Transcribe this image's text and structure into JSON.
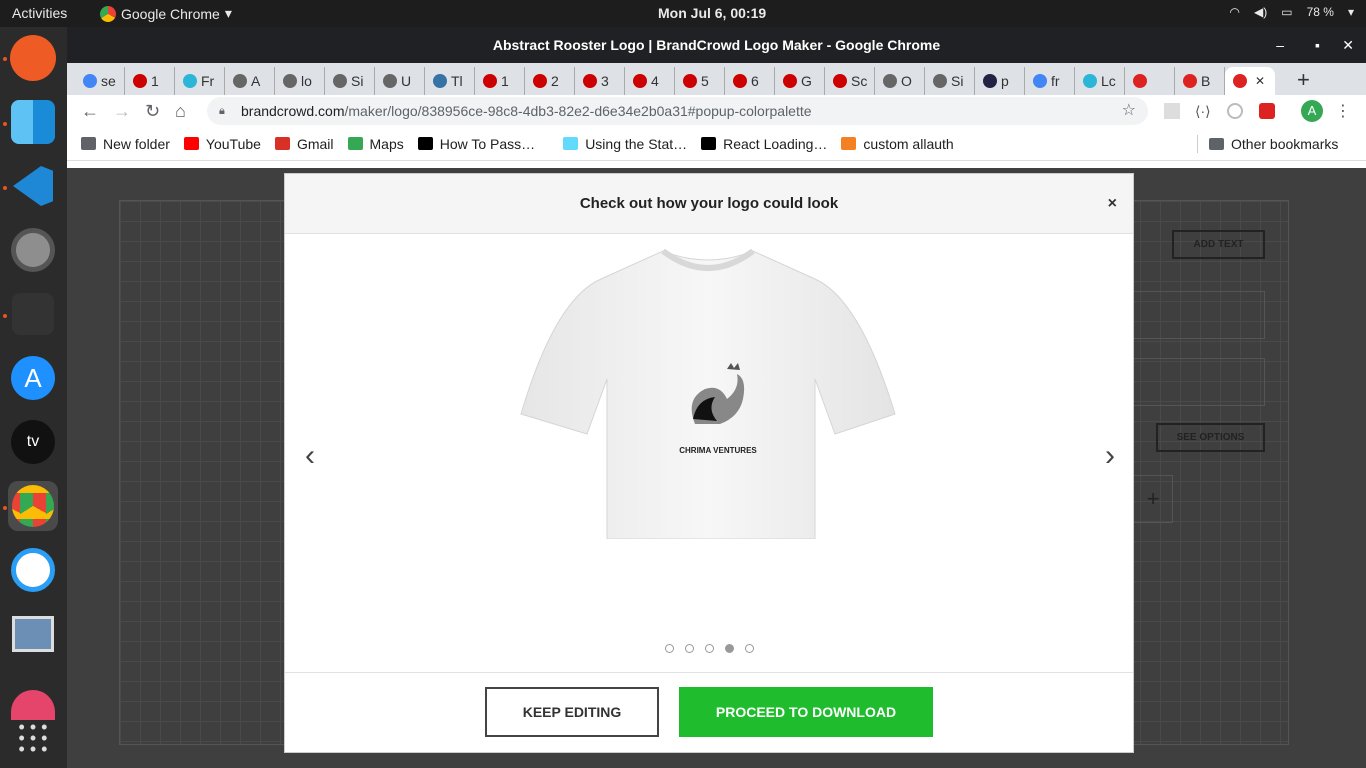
{
  "os": {
    "activities": "Activities",
    "app_name": "Google Chrome",
    "clock": "Mon Jul  6, 00:19",
    "battery": "78 %"
  },
  "window": {
    "title": "Abstract Rooster Logo | BrandCrowd Logo Maker - Google Chrome"
  },
  "tabs": [
    "se",
    "1",
    "Fr",
    "A",
    "lo",
    "Si",
    "U",
    "Tl",
    "1",
    "2",
    "3",
    "4",
    "5",
    "6",
    "G",
    "Sc",
    "O",
    "Si",
    "p",
    "fr",
    "Lc",
    "",
    "B",
    ""
  ],
  "address": {
    "domain": "brandcrowd.com",
    "path": "/maker/logo/838956ce-98c8-4db3-82e2-d6e34e2b0a31#popup-colorpalette"
  },
  "bookmarks": [
    "New folder",
    "YouTube",
    "Gmail",
    "Maps",
    "How To Pass…",
    "Using the Stat…",
    "React Loading…",
    "custom allauth"
  ],
  "other_bookmarks": "Other bookmarks",
  "profile_initial": "A",
  "modal": {
    "title": "Check out how your logo could look",
    "close": "×",
    "logo_text": "CHRIMA VENTURES",
    "keep_editing": "KEEP EDITING",
    "proceed": "PROCEED TO DOWNLOAD",
    "active_slide": 4
  },
  "editor": {
    "add_text": "ADD TEXT",
    "see_options": "SEE OPTIONS",
    "plus": "+"
  },
  "colors": {
    "accent_green": "#1fbd2e",
    "ubuntu_orange": "#e95420"
  }
}
